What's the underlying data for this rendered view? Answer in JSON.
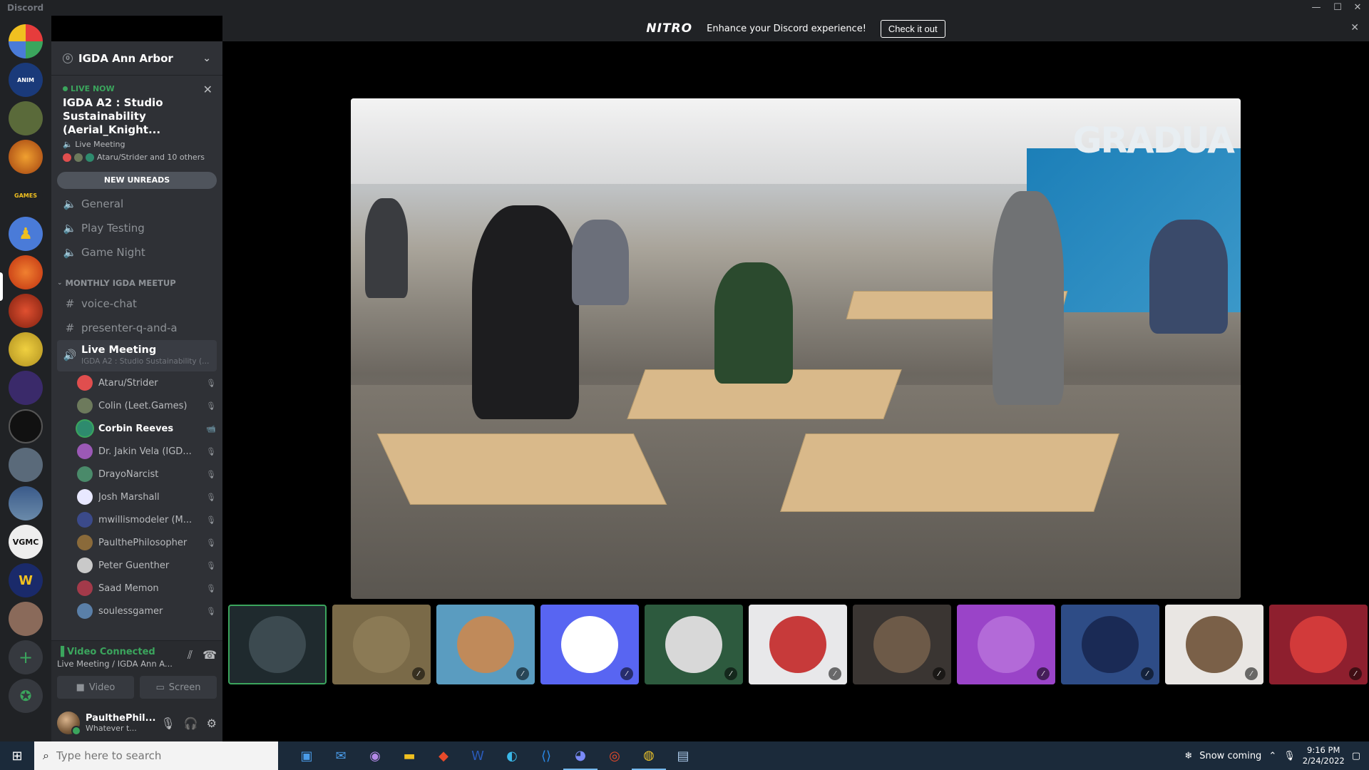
{
  "window": {
    "title": "Discord",
    "minimize": "—",
    "maximize": "☐",
    "close": "✕"
  },
  "nitro": {
    "logo": "NITRO",
    "message": "Enhance your Discord experience!",
    "cta": "Check it out",
    "close": "✕"
  },
  "server": {
    "name": "IGDA Ann Arbor",
    "badge": "0"
  },
  "live": {
    "label": "LIVE NOW",
    "title": "IGDA A2 : Studio Sustainability (Aerial_Knight...",
    "channel": "Live Meeting",
    "attendees": "Ataru/Strider and 10 others"
  },
  "new_unreads": "NEW UNREADS",
  "voice_channels": [
    {
      "name": "General"
    },
    {
      "name": "Play Testing"
    },
    {
      "name": "Game Night"
    }
  ],
  "category": "MONTHLY IGDA MEETUP",
  "text_channels": [
    {
      "name": "voice-chat"
    },
    {
      "name": "presenter-q-and-a"
    }
  ],
  "active_channel": {
    "name": "Live Meeting",
    "subtitle": "IGDA A2 : Studio Sustainability (A..."
  },
  "voice_users": [
    {
      "name": "Ataru/Strider",
      "status": "🎙",
      "color": "#e04e4e"
    },
    {
      "name": "Colin (Leet.Games)",
      "status": "🎙",
      "color": "#6d7a5c"
    },
    {
      "name": "Corbin Reeves",
      "status": "📹",
      "color": "#2e8b6e",
      "speaking": true
    },
    {
      "name": "Dr. Jakin Vela (IGD...",
      "status": "🎙",
      "color": "#9b59b6"
    },
    {
      "name": "DrayoNarcist",
      "status": "🎙",
      "color": "#4a8a6a"
    },
    {
      "name": "Josh Marshall",
      "status": "🎙",
      "color": "#e8e8ff"
    },
    {
      "name": "mwillismodeler (M...",
      "status": "🎙",
      "color": "#3b4a8a"
    },
    {
      "name": "PaulthePhilosopher",
      "status": "🎙",
      "color": "#8a6a3a"
    },
    {
      "name": "Peter Guenther",
      "status": "🎙",
      "color": "#c9c9c9"
    },
    {
      "name": "Saad Memon",
      "status": "🎙",
      "color": "#a33a4a"
    },
    {
      "name": "soulessgamer",
      "status": "🎙",
      "color": "#5a7fa8"
    }
  ],
  "voice_status": {
    "title": "Video Connected",
    "subtitle": "Live Meeting / IGDA Ann A...",
    "video_label": "Video",
    "screen_label": "Screen"
  },
  "user": {
    "name": "PaulthePhil...",
    "status": "Whatever t..."
  },
  "tiles": [
    {
      "bg": "#1f2a2e",
      "av": "#3c4a50",
      "focused": true
    },
    {
      "bg": "#7a6a48",
      "av": "#8b7a55"
    },
    {
      "bg": "#5a9cc0",
      "av": "#c08a5a"
    },
    {
      "bg": "#5865f2",
      "av": "#ffffff"
    },
    {
      "bg": "#2d5a3e",
      "av": "#d8d8d8"
    },
    {
      "bg": "#e8e8ea",
      "av": "#c73a3a"
    },
    {
      "bg": "#3a3532",
      "av": "#6d5a48"
    },
    {
      "bg": "#9a44c8",
      "av": "#b36ad8"
    },
    {
      "bg": "#2e4c86",
      "av": "#1a2a55"
    },
    {
      "bg": "#e9e6e3",
      "av": "#7a6048"
    },
    {
      "bg": "#8e1f2e",
      "av": "#d23a3a"
    }
  ],
  "taskbar": {
    "search_placeholder": "Type here to search",
    "weather": "Snow coming",
    "time": "9:16 PM",
    "date": "2/24/2022"
  }
}
